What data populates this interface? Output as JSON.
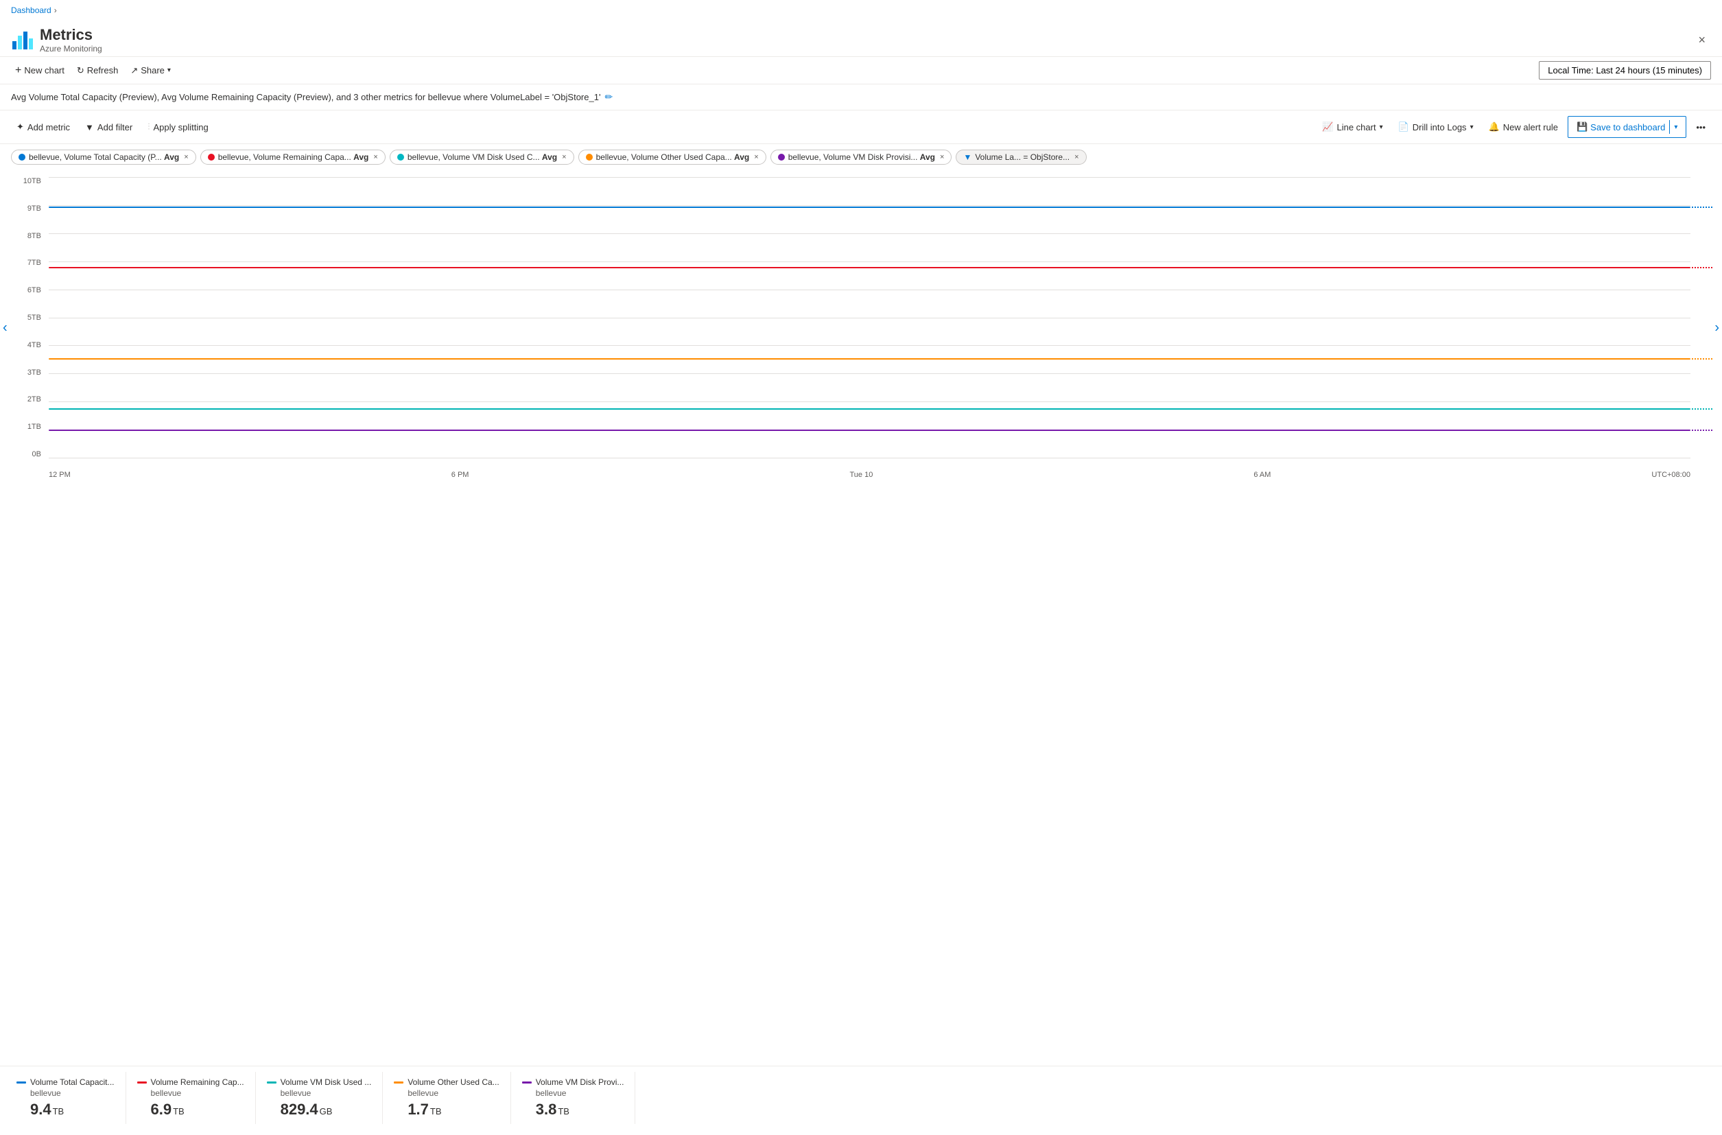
{
  "breadcrumb": {
    "dashboard": "Dashboard",
    "chevron": "›"
  },
  "header": {
    "title": "Metrics",
    "subtitle": "Azure Monitoring",
    "close_label": "×"
  },
  "toolbar": {
    "new_chart": "New chart",
    "refresh": "Refresh",
    "share": "Share",
    "chevron": "∨",
    "time_range": "Local Time: Last 24 hours (15 minutes)"
  },
  "chart_title": "Avg Volume Total Capacity (Preview), Avg Volume Remaining Capacity (Preview), and 3 other metrics for bellevue where VolumeLabel = 'ObjStore_1'",
  "actions": {
    "add_metric": "Add metric",
    "add_filter": "Add filter",
    "apply_splitting": "Apply splitting",
    "line_chart": "Line chart",
    "drill_into_logs": "Drill into Logs",
    "new_alert_rule": "New alert rule",
    "save_to_dashboard": "Save to dashboard"
  },
  "tags": [
    {
      "id": "t1",
      "color": "#0078d4",
      "text": "bellevue, Volume Total Capacity (P...",
      "suffix": "Avg",
      "removable": true
    },
    {
      "id": "t2",
      "color": "#e81123",
      "text": "bellevue, Volume Remaining Capa...",
      "suffix": "Avg",
      "removable": true
    },
    {
      "id": "t3",
      "color": "#00b7c3",
      "text": "bellevue, Volume VM Disk Used C...",
      "suffix": "Avg",
      "removable": true
    },
    {
      "id": "t4",
      "color": "#ff8c00",
      "text": "bellevue, Volume Other Used Capa...",
      "suffix": "Avg",
      "removable": true
    },
    {
      "id": "t5",
      "color": "#7719aa",
      "text": "bellevue, Volume VM Disk Provisi...",
      "suffix": "Avg",
      "removable": true
    },
    {
      "id": "t6",
      "filter": true,
      "text": "Volume La...  =  ObjStore...",
      "removable": true
    }
  ],
  "yAxis": {
    "labels": [
      "10TB",
      "9TB",
      "8TB",
      "7TB",
      "6TB",
      "5TB",
      "4TB",
      "3TB",
      "2TB",
      "1TB",
      "0B"
    ]
  },
  "xAxis": {
    "labels": [
      "12 PM",
      "6 PM",
      "Tue 10",
      "6 AM",
      "UTC+08:00"
    ]
  },
  "chart_lines": [
    {
      "id": "line1",
      "color": "#0078d4",
      "top_pct": 10.5,
      "dashed_color": "#0078d4"
    },
    {
      "id": "line2",
      "color": "#e81123",
      "top_pct": 32.0,
      "dashed_color": "#e81123"
    },
    {
      "id": "line3",
      "color": "#ff8c00",
      "top_pct": 64.5,
      "dashed_color": "#ff8c00"
    },
    {
      "id": "line4",
      "color": "#00b4b4",
      "top_pct": 82.5,
      "dashed_color": "#00b4b4"
    },
    {
      "id": "line5",
      "color": "#7719aa",
      "top_pct": 90.0,
      "dashed_color": "#7719aa"
    }
  ],
  "legend": [
    {
      "id": "l1",
      "color": "#0078d4",
      "name": "Volume Total Capacit...",
      "sub": "bellevue",
      "value": "9.4",
      "unit": "TB"
    },
    {
      "id": "l2",
      "color": "#e81123",
      "name": "Volume Remaining Cap...",
      "sub": "bellevue",
      "value": "6.9",
      "unit": "TB"
    },
    {
      "id": "l3",
      "color": "#00b4b4",
      "name": "Volume VM Disk Used ...",
      "sub": "bellevue",
      "value": "829.4",
      "unit": "GB"
    },
    {
      "id": "l4",
      "color": "#ff8c00",
      "name": "Volume Other Used Ca...",
      "sub": "bellevue",
      "value": "1.7",
      "unit": "TB"
    },
    {
      "id": "l5",
      "color": "#7719aa",
      "name": "Volume VM Disk Provi...",
      "sub": "bellevue",
      "value": "3.8",
      "unit": "TB"
    }
  ]
}
